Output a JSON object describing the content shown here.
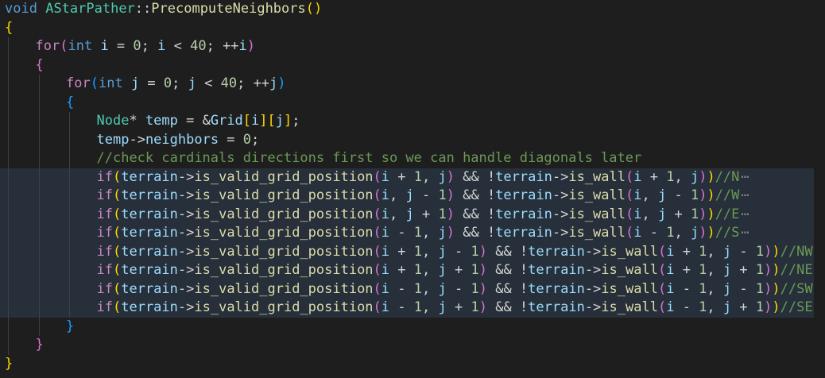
{
  "editor": {
    "fold_marker": "⋯",
    "lines": [
      {
        "indent": 0,
        "hl": false,
        "tokens": [
          [
            "kw",
            "void"
          ],
          [
            "op",
            " "
          ],
          [
            "ty",
            "AStarPather"
          ],
          [
            "op",
            "::"
          ],
          [
            "fn",
            "PrecomputeNeighbors"
          ],
          [
            "b1",
            "()"
          ]
        ]
      },
      {
        "indent": 0,
        "hl": false,
        "tokens": [
          [
            "b1",
            "{"
          ]
        ]
      },
      {
        "indent": 1,
        "hl": false,
        "tokens": [
          [
            "ctl",
            "for"
          ],
          [
            "b2",
            "("
          ],
          [
            "kw",
            "int"
          ],
          [
            "op",
            " "
          ],
          [
            "var",
            "i"
          ],
          [
            "op",
            " = "
          ],
          [
            "num",
            "0"
          ],
          [
            "op",
            "; "
          ],
          [
            "var",
            "i"
          ],
          [
            "op",
            " < "
          ],
          [
            "num",
            "40"
          ],
          [
            "op",
            "; ++"
          ],
          [
            "var",
            "i"
          ],
          [
            "b2",
            ")"
          ]
        ]
      },
      {
        "indent": 1,
        "hl": false,
        "tokens": [
          [
            "b2",
            "{"
          ]
        ]
      },
      {
        "indent": 2,
        "hl": false,
        "tokens": [
          [
            "ctl",
            "for"
          ],
          [
            "b3",
            "("
          ],
          [
            "kw",
            "int"
          ],
          [
            "op",
            " "
          ],
          [
            "var",
            "j"
          ],
          [
            "op",
            " = "
          ],
          [
            "num",
            "0"
          ],
          [
            "op",
            "; "
          ],
          [
            "var",
            "j"
          ],
          [
            "op",
            " < "
          ],
          [
            "num",
            "40"
          ],
          [
            "op",
            "; ++"
          ],
          [
            "var",
            "j"
          ],
          [
            "b3",
            ")"
          ]
        ]
      },
      {
        "indent": 2,
        "hl": false,
        "tokens": [
          [
            "b3",
            "{"
          ]
        ]
      },
      {
        "indent": 3,
        "hl": false,
        "tokens": [
          [
            "ty",
            "Node"
          ],
          [
            "op",
            "* "
          ],
          [
            "var",
            "temp"
          ],
          [
            "op",
            " = &"
          ],
          [
            "var",
            "Grid"
          ],
          [
            "b1",
            "["
          ],
          [
            "var",
            "i"
          ],
          [
            "b1",
            "]"
          ],
          [
            "b1",
            "["
          ],
          [
            "var",
            "j"
          ],
          [
            "b1",
            "]"
          ],
          [
            "op",
            ";"
          ]
        ]
      },
      {
        "indent": 3,
        "hl": false,
        "tokens": [
          [
            "var",
            "temp"
          ],
          [
            "op",
            "->"
          ],
          [
            "var",
            "neighbors"
          ],
          [
            "op",
            " = "
          ],
          [
            "num",
            "0"
          ],
          [
            "op",
            ";"
          ]
        ]
      },
      {
        "indent": 3,
        "hl": false,
        "tokens": [
          [
            "cm",
            "//check cardinals directions first so we can handle diagonals later"
          ]
        ]
      },
      {
        "indent": 3,
        "hl": true,
        "fold": true,
        "tokens": [
          [
            "ctl",
            "if"
          ],
          [
            "b1",
            "("
          ],
          [
            "var",
            "terrain"
          ],
          [
            "op",
            "->"
          ],
          [
            "fn",
            "is_valid_grid_position"
          ],
          [
            "b2",
            "("
          ],
          [
            "var",
            "i"
          ],
          [
            "op",
            " + "
          ],
          [
            "num",
            "1"
          ],
          [
            "op",
            ", "
          ],
          [
            "var",
            "j"
          ],
          [
            "b2",
            ")"
          ],
          [
            "op",
            " && !"
          ],
          [
            "var",
            "terrain"
          ],
          [
            "op",
            "->"
          ],
          [
            "fn",
            "is_wall"
          ],
          [
            "b2",
            "("
          ],
          [
            "var",
            "i"
          ],
          [
            "op",
            " + "
          ],
          [
            "num",
            "1"
          ],
          [
            "op",
            ", "
          ],
          [
            "var",
            "j"
          ],
          [
            "b2",
            ")"
          ],
          [
            "b1",
            ")"
          ],
          [
            "cm",
            "//N"
          ]
        ]
      },
      {
        "indent": 3,
        "hl": true,
        "fold": true,
        "tokens": [
          [
            "ctl",
            "if"
          ],
          [
            "b1",
            "("
          ],
          [
            "var",
            "terrain"
          ],
          [
            "op",
            "->"
          ],
          [
            "fn",
            "is_valid_grid_position"
          ],
          [
            "b2",
            "("
          ],
          [
            "var",
            "i"
          ],
          [
            "op",
            ", "
          ],
          [
            "var",
            "j"
          ],
          [
            "op",
            " - "
          ],
          [
            "num",
            "1"
          ],
          [
            "b2",
            ")"
          ],
          [
            "op",
            " && !"
          ],
          [
            "var",
            "terrain"
          ],
          [
            "op",
            "->"
          ],
          [
            "fn",
            "is_wall"
          ],
          [
            "b2",
            "("
          ],
          [
            "var",
            "i"
          ],
          [
            "op",
            ", "
          ],
          [
            "var",
            "j"
          ],
          [
            "op",
            " - "
          ],
          [
            "num",
            "1"
          ],
          [
            "b2",
            ")"
          ],
          [
            "b1",
            ")"
          ],
          [
            "cm",
            "//W"
          ]
        ]
      },
      {
        "indent": 3,
        "hl": true,
        "fold": true,
        "tokens": [
          [
            "ctl",
            "if"
          ],
          [
            "b1",
            "("
          ],
          [
            "var",
            "terrain"
          ],
          [
            "op",
            "->"
          ],
          [
            "fn",
            "is_valid_grid_position"
          ],
          [
            "b2",
            "("
          ],
          [
            "var",
            "i"
          ],
          [
            "op",
            ", "
          ],
          [
            "var",
            "j"
          ],
          [
            "op",
            " + "
          ],
          [
            "num",
            "1"
          ],
          [
            "b2",
            ")"
          ],
          [
            "op",
            " && !"
          ],
          [
            "var",
            "terrain"
          ],
          [
            "op",
            "->"
          ],
          [
            "fn",
            "is_wall"
          ],
          [
            "b2",
            "("
          ],
          [
            "var",
            "i"
          ],
          [
            "op",
            ", "
          ],
          [
            "var",
            "j"
          ],
          [
            "op",
            " + "
          ],
          [
            "num",
            "1"
          ],
          [
            "b2",
            ")"
          ],
          [
            "b1",
            ")"
          ],
          [
            "cm",
            "//E"
          ]
        ]
      },
      {
        "indent": 3,
        "hl": true,
        "fold": true,
        "tokens": [
          [
            "ctl",
            "if"
          ],
          [
            "b1",
            "("
          ],
          [
            "var",
            "terrain"
          ],
          [
            "op",
            "->"
          ],
          [
            "fn",
            "is_valid_grid_position"
          ],
          [
            "b2",
            "("
          ],
          [
            "var",
            "i"
          ],
          [
            "op",
            " - "
          ],
          [
            "num",
            "1"
          ],
          [
            "op",
            ", "
          ],
          [
            "var",
            "j"
          ],
          [
            "b2",
            ")"
          ],
          [
            "op",
            " && !"
          ],
          [
            "var",
            "terrain"
          ],
          [
            "op",
            "->"
          ],
          [
            "fn",
            "is_wall"
          ],
          [
            "b2",
            "("
          ],
          [
            "var",
            "i"
          ],
          [
            "op",
            " - "
          ],
          [
            "num",
            "1"
          ],
          [
            "op",
            ", "
          ],
          [
            "var",
            "j"
          ],
          [
            "b2",
            ")"
          ],
          [
            "b1",
            ")"
          ],
          [
            "cm",
            "//S"
          ]
        ]
      },
      {
        "indent": 3,
        "hl": true,
        "fold": true,
        "tokens": [
          [
            "ctl",
            "if"
          ],
          [
            "b1",
            "("
          ],
          [
            "var",
            "terrain"
          ],
          [
            "op",
            "->"
          ],
          [
            "fn",
            "is_valid_grid_position"
          ],
          [
            "b2",
            "("
          ],
          [
            "var",
            "i"
          ],
          [
            "op",
            " + "
          ],
          [
            "num",
            "1"
          ],
          [
            "op",
            ", "
          ],
          [
            "var",
            "j"
          ],
          [
            "op",
            " - "
          ],
          [
            "num",
            "1"
          ],
          [
            "b2",
            ")"
          ],
          [
            "op",
            " && !"
          ],
          [
            "var",
            "terrain"
          ],
          [
            "op",
            "->"
          ],
          [
            "fn",
            "is_wall"
          ],
          [
            "b2",
            "("
          ],
          [
            "var",
            "i"
          ],
          [
            "op",
            " + "
          ],
          [
            "num",
            "1"
          ],
          [
            "op",
            ", "
          ],
          [
            "var",
            "j"
          ],
          [
            "op",
            " - "
          ],
          [
            "num",
            "1"
          ],
          [
            "b2",
            ")"
          ],
          [
            "b1",
            ")"
          ],
          [
            "cm",
            "//NW"
          ]
        ]
      },
      {
        "indent": 3,
        "hl": true,
        "fold": true,
        "tokens": [
          [
            "ctl",
            "if"
          ],
          [
            "b1",
            "("
          ],
          [
            "var",
            "terrain"
          ],
          [
            "op",
            "->"
          ],
          [
            "fn",
            "is_valid_grid_position"
          ],
          [
            "b2",
            "("
          ],
          [
            "var",
            "i"
          ],
          [
            "op",
            " + "
          ],
          [
            "num",
            "1"
          ],
          [
            "op",
            ", "
          ],
          [
            "var",
            "j"
          ],
          [
            "op",
            " + "
          ],
          [
            "num",
            "1"
          ],
          [
            "b2",
            ")"
          ],
          [
            "op",
            " && !"
          ],
          [
            "var",
            "terrain"
          ],
          [
            "op",
            "->"
          ],
          [
            "fn",
            "is_wall"
          ],
          [
            "b2",
            "("
          ],
          [
            "var",
            "i"
          ],
          [
            "op",
            " + "
          ],
          [
            "num",
            "1"
          ],
          [
            "op",
            ", "
          ],
          [
            "var",
            "j"
          ],
          [
            "op",
            " + "
          ],
          [
            "num",
            "1"
          ],
          [
            "b2",
            ")"
          ],
          [
            "b1",
            ")"
          ],
          [
            "cm",
            "//NE"
          ]
        ]
      },
      {
        "indent": 3,
        "hl": true,
        "fold": true,
        "tokens": [
          [
            "ctl",
            "if"
          ],
          [
            "b1",
            "("
          ],
          [
            "var",
            "terrain"
          ],
          [
            "op",
            "->"
          ],
          [
            "fn",
            "is_valid_grid_position"
          ],
          [
            "b2",
            "("
          ],
          [
            "var",
            "i"
          ],
          [
            "op",
            " - "
          ],
          [
            "num",
            "1"
          ],
          [
            "op",
            ", "
          ],
          [
            "var",
            "j"
          ],
          [
            "op",
            " - "
          ],
          [
            "num",
            "1"
          ],
          [
            "b2",
            ")"
          ],
          [
            "op",
            " && !"
          ],
          [
            "var",
            "terrain"
          ],
          [
            "op",
            "->"
          ],
          [
            "fn",
            "is_wall"
          ],
          [
            "b2",
            "("
          ],
          [
            "var",
            "i"
          ],
          [
            "op",
            " - "
          ],
          [
            "num",
            "1"
          ],
          [
            "op",
            ", "
          ],
          [
            "var",
            "j"
          ],
          [
            "op",
            " - "
          ],
          [
            "num",
            "1"
          ],
          [
            "b2",
            ")"
          ],
          [
            "b1",
            ")"
          ],
          [
            "cm",
            "//SW"
          ]
        ]
      },
      {
        "indent": 3,
        "hl": true,
        "fold": true,
        "tokens": [
          [
            "ctl",
            "if"
          ],
          [
            "b1",
            "("
          ],
          [
            "var",
            "terrain"
          ],
          [
            "op",
            "->"
          ],
          [
            "fn",
            "is_valid_grid_position"
          ],
          [
            "b2",
            "("
          ],
          [
            "var",
            "i"
          ],
          [
            "op",
            " - "
          ],
          [
            "num",
            "1"
          ],
          [
            "op",
            ", "
          ],
          [
            "var",
            "j"
          ],
          [
            "op",
            " + "
          ],
          [
            "num",
            "1"
          ],
          [
            "b2",
            ")"
          ],
          [
            "op",
            " && !"
          ],
          [
            "var",
            "terrain"
          ],
          [
            "op",
            "->"
          ],
          [
            "fn",
            "is_wall"
          ],
          [
            "b2",
            "("
          ],
          [
            "var",
            "i"
          ],
          [
            "op",
            " - "
          ],
          [
            "num",
            "1"
          ],
          [
            "op",
            ", "
          ],
          [
            "var",
            "j"
          ],
          [
            "op",
            " + "
          ],
          [
            "num",
            "1"
          ],
          [
            "b2",
            ")"
          ],
          [
            "b1",
            ")"
          ],
          [
            "cm",
            "//SE"
          ]
        ]
      },
      {
        "indent": 2,
        "hl": false,
        "tokens": [
          [
            "b3",
            "}"
          ]
        ]
      },
      {
        "indent": 1,
        "hl": false,
        "tokens": [
          [
            "b2",
            "}"
          ]
        ]
      },
      {
        "indent": 0,
        "hl": false,
        "tokens": [
          [
            "b1",
            "}"
          ]
        ]
      }
    ]
  }
}
